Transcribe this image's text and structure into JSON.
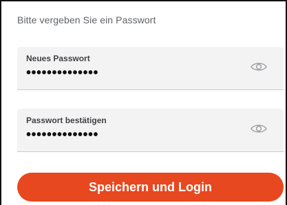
{
  "form": {
    "instruction": "Bitte vergeben Sie ein Passwort",
    "fields": [
      {
        "label": "Neues Passwort",
        "value": "••••••••••••••",
        "toggle_icon": "eye-icon"
      },
      {
        "label": "Passwort bestätigen",
        "value": "••••••••••••••",
        "toggle_icon": "eye-icon"
      }
    ],
    "submit_label": "Speichern und Login"
  },
  "colors": {
    "accent": "#e8481f",
    "field_background": "#f3f3f4",
    "text": "#111111"
  }
}
